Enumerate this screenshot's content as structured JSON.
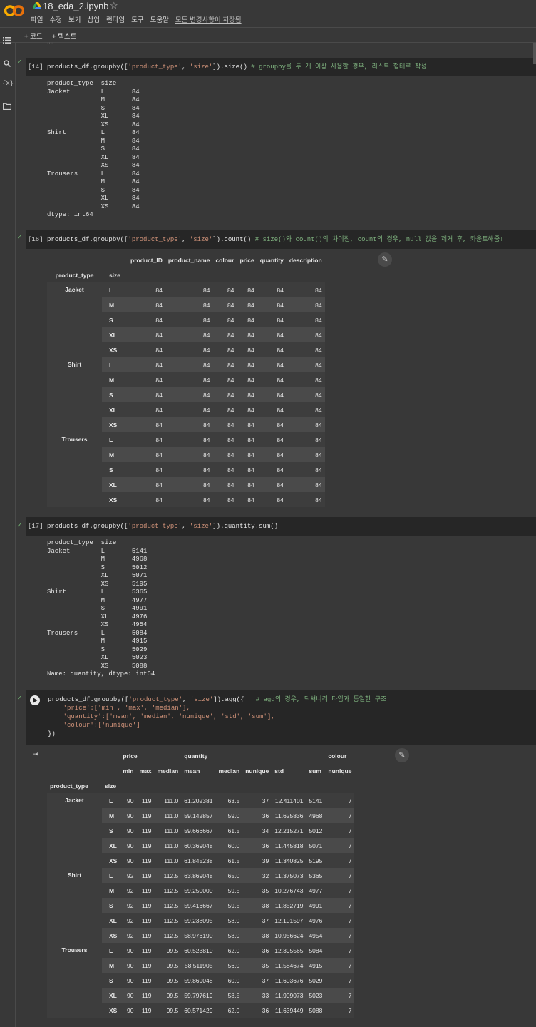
{
  "app": {
    "title": "18_eda_2.ipynb",
    "menu": [
      "파일",
      "수정",
      "보기",
      "삽입",
      "런타임",
      "도구",
      "도움말"
    ],
    "saved_status": "모든 변경사항이 저장됨",
    "toolbar": {
      "code": "+ 코드",
      "text": "+ 텍스트"
    },
    "sidebar_icons": [
      "menu-icon",
      "search-icon",
      "variables-icon",
      "folder-icon"
    ],
    "variables_label": "{x}"
  },
  "cells": {
    "c14": {
      "prompt": "[14]",
      "code_pre": "products_df.groupby([",
      "code_str1": "'product_type'",
      "code_mid": ", ",
      "code_str2": "'size'",
      "code_post": "]).size() ",
      "comment": "# groupby를 두 개 이상 사용할 경우, 리스트 형태로 작성",
      "output": "product_type  size\nJacket        L       84\n              M       84\n              S       84\n              XL      84\n              XS      84\nShirt         L       84\n              M       84\n              S       84\n              XL      84\n              XS      84\nTrousers      L       84\n              M       84\n              S       84\n              XL      84\n              XS      84\ndtype: int64"
    },
    "c16": {
      "prompt": "[16]",
      "code_pre": "products_df.groupby([",
      "code_str1": "'product_type'",
      "code_mid": ", ",
      "code_str2": "'size'",
      "code_post": "]).count() ",
      "comment": "# size()와 count()의 차이점, count의 경우, null 값을 제거 후, 카운트해줌!",
      "columns": [
        "product_ID",
        "product_name",
        "colour",
        "price",
        "quantity",
        "description"
      ],
      "index_names": [
        "product_type",
        "size"
      ],
      "groups": [
        "Jacket",
        "Shirt",
        "Trousers"
      ],
      "sizes": [
        "L",
        "M",
        "S",
        "XL",
        "XS"
      ],
      "value": "84"
    },
    "c17": {
      "prompt": "[17]",
      "code_pre": "products_df.groupby([",
      "code_str1": "'product_type'",
      "code_mid": ", ",
      "code_str2": "'size'",
      "code_post": "]).quantity.sum()",
      "output": "product_type  size\nJacket        L       5141\n              M       4968\n              S       5012\n              XL      5071\n              XS      5195\nShirt         L       5365\n              M       4977\n              S       4991\n              XL      4976\n              XS      4954\nTrousers      L       5084\n              M       4915\n              S       5029\n              XL      5023\n              XS      5088\nName: quantity, dtype: int64"
    },
    "c18": {
      "line1_pre": "products_df.groupby([",
      "line1_str1": "'product_type'",
      "line1_mid": ", ",
      "line1_str2": "'size'",
      "line1_post": "]).agg({   ",
      "line1_comment": "# agg의 경우, 딕셔너리 타입과 동일한 구조",
      "line2": "    'price':['min', 'max', 'median'],",
      "line3": "    'quantity':['mean', 'median', 'nunique', 'std', 'sum'],",
      "line4": "    'colour':['nunique']",
      "line5": "})",
      "header_top": [
        "price",
        "quantity",
        "colour"
      ],
      "header_sub": [
        "min",
        "max",
        "median",
        "mean",
        "median",
        "nunique",
        "std",
        "sum",
        "nunique"
      ],
      "index_names": [
        "product_type",
        "size"
      ],
      "rows": [
        [
          "Jacket",
          "L",
          "90",
          "119",
          "111.0",
          "61.202381",
          "63.5",
          "37",
          "12.411401",
          "5141",
          "7"
        ],
        [
          "",
          "M",
          "90",
          "119",
          "111.0",
          "59.142857",
          "59.0",
          "36",
          "11.625836",
          "4968",
          "7"
        ],
        [
          "",
          "S",
          "90",
          "119",
          "111.0",
          "59.666667",
          "61.5",
          "34",
          "12.215271",
          "5012",
          "7"
        ],
        [
          "",
          "XL",
          "90",
          "119",
          "111.0",
          "60.369048",
          "60.0",
          "36",
          "11.445818",
          "5071",
          "7"
        ],
        [
          "",
          "XS",
          "90",
          "119",
          "111.0",
          "61.845238",
          "61.5",
          "39",
          "11.340825",
          "5195",
          "7"
        ],
        [
          "Shirt",
          "L",
          "92",
          "119",
          "112.5",
          "63.869048",
          "65.0",
          "32",
          "11.375073",
          "5365",
          "7"
        ],
        [
          "",
          "M",
          "92",
          "119",
          "112.5",
          "59.250000",
          "59.5",
          "35",
          "10.276743",
          "4977",
          "7"
        ],
        [
          "",
          "S",
          "92",
          "119",
          "112.5",
          "59.416667",
          "59.5",
          "38",
          "11.852719",
          "4991",
          "7"
        ],
        [
          "",
          "XL",
          "92",
          "119",
          "112.5",
          "59.238095",
          "58.0",
          "37",
          "12.101597",
          "4976",
          "7"
        ],
        [
          "",
          "XS",
          "92",
          "119",
          "112.5",
          "58.976190",
          "58.0",
          "38",
          "10.956624",
          "4954",
          "7"
        ],
        [
          "Trousers",
          "L",
          "90",
          "119",
          "99.5",
          "60.523810",
          "62.0",
          "36",
          "12.395565",
          "5084",
          "7"
        ],
        [
          "",
          "M",
          "90",
          "119",
          "99.5",
          "58.511905",
          "56.0",
          "35",
          "11.584674",
          "4915",
          "7"
        ],
        [
          "",
          "S",
          "90",
          "119",
          "99.5",
          "59.869048",
          "60.0",
          "37",
          "11.603676",
          "5029",
          "7"
        ],
        [
          "",
          "XL",
          "90",
          "119",
          "99.5",
          "59.797619",
          "58.5",
          "33",
          "11.909073",
          "5023",
          "7"
        ],
        [
          "",
          "XS",
          "90",
          "119",
          "99.5",
          "60.571429",
          "62.0",
          "36",
          "11.639449",
          "5088",
          "7"
        ]
      ]
    }
  }
}
